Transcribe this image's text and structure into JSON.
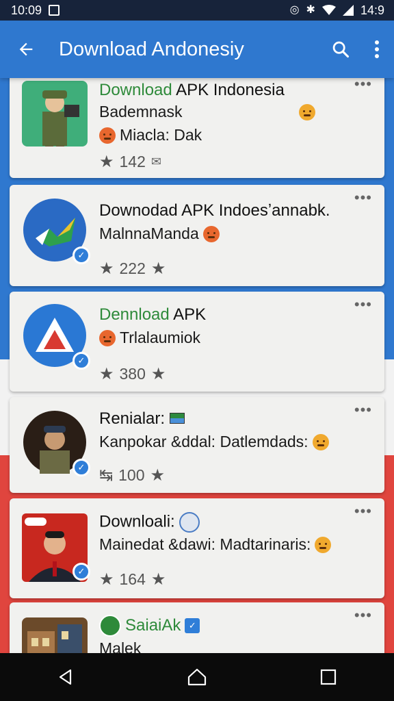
{
  "status_bar": {
    "time": "10:09",
    "battery_time": "14:9",
    "icons": [
      "image-icon",
      "signal-off-icon",
      "bluetooth-icon",
      "wifi-icon",
      "cell-signal-icon"
    ]
  },
  "app_bar": {
    "title": "Download Andonesiy",
    "back_icon": "arrow-back-icon",
    "search_icon": "search-icon",
    "more_icon": "more-vert-icon"
  },
  "items": [
    {
      "title_green": "Download",
      "title_rest": " APK Indonesia",
      "subtitle": "Bademnask",
      "line3": "Miacla: Dak",
      "count": "142",
      "thumb": "soldier-avatar",
      "more": "•••"
    },
    {
      "title_green": "",
      "title_rest": "Downodad APK Indoesʼannabk.",
      "subtitle": "MalnnaManda",
      "count": "222",
      "thumb": "blue-check-logo",
      "more": "•••"
    },
    {
      "title_green": "Dennload",
      "title_rest": " APK",
      "subtitle": "Trlalaumiok",
      "count": "380",
      "thumb": "delta-logo",
      "more": "•••"
    },
    {
      "title_green": "",
      "title_rest": "Renialar:",
      "subtitle": "Kanpokar &ddal: Datlemdads:",
      "count": "100",
      "thumb": "officer-avatar",
      "more": "•••"
    },
    {
      "title_green": "",
      "title_rest": "Downloali:",
      "subtitle": "Mainedat &dawi: Madtarinaris:",
      "count": "164",
      "thumb": "man-red-bg",
      "more": "•••"
    },
    {
      "title_green": "SaiaiAk",
      "title_rest": "",
      "subtitle": "Malek",
      "thumb": "building-photo",
      "more": "•••"
    }
  ],
  "colors": {
    "primary": "#2f78cf",
    "green_text": "#2e8a3a",
    "red_band": "#e0453e"
  }
}
